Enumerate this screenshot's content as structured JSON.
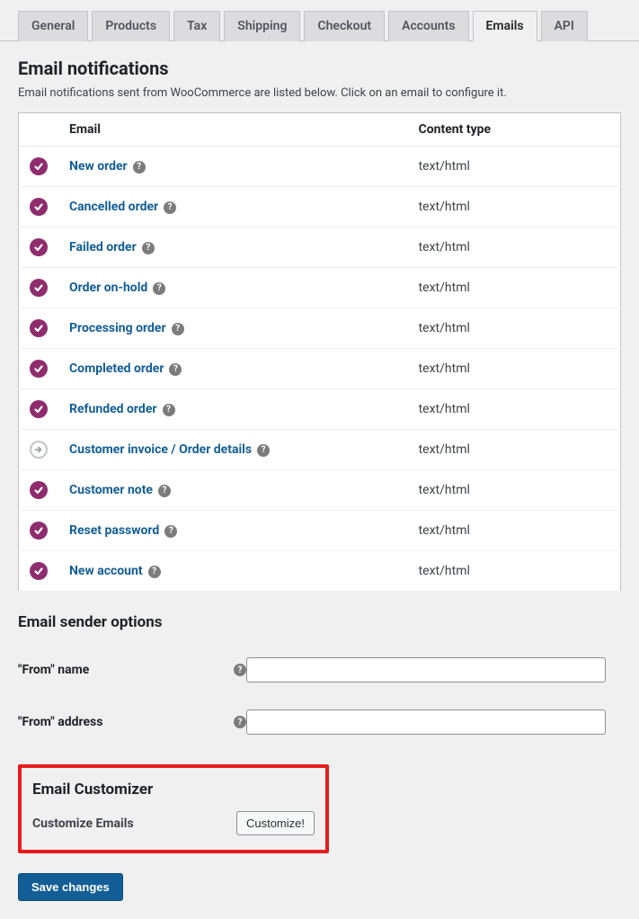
{
  "tabs": [
    {
      "label": "General"
    },
    {
      "label": "Products"
    },
    {
      "label": "Tax"
    },
    {
      "label": "Shipping"
    },
    {
      "label": "Checkout"
    },
    {
      "label": "Accounts"
    },
    {
      "label": "Emails"
    },
    {
      "label": "API"
    }
  ],
  "active_tab_index": 6,
  "section": {
    "heading": "Email notifications",
    "description": "Email notifications sent from WooCommerce are listed below. Click on an email to configure it."
  },
  "table": {
    "columns": {
      "email": "Email",
      "content_type": "Content type"
    },
    "rows": [
      {
        "status": "enabled",
        "name": "New order",
        "content_type": "text/html"
      },
      {
        "status": "enabled",
        "name": "Cancelled order",
        "content_type": "text/html"
      },
      {
        "status": "enabled",
        "name": "Failed order",
        "content_type": "text/html"
      },
      {
        "status": "enabled",
        "name": "Order on-hold",
        "content_type": "text/html"
      },
      {
        "status": "enabled",
        "name": "Processing order",
        "content_type": "text/html"
      },
      {
        "status": "enabled",
        "name": "Completed order",
        "content_type": "text/html"
      },
      {
        "status": "enabled",
        "name": "Refunded order",
        "content_type": "text/html"
      },
      {
        "status": "manual",
        "name": "Customer invoice / Order details",
        "content_type": "text/html"
      },
      {
        "status": "enabled",
        "name": "Customer note",
        "content_type": "text/html"
      },
      {
        "status": "enabled",
        "name": "Reset password",
        "content_type": "text/html"
      },
      {
        "status": "enabled",
        "name": "New account",
        "content_type": "text/html"
      }
    ]
  },
  "sender": {
    "heading": "Email sender options",
    "from_name_label": "\"From\" name",
    "from_name_value": "",
    "from_address_label": "\"From\" address",
    "from_address_value": ""
  },
  "customizer": {
    "heading": "Email Customizer",
    "row_label": "Customize Emails",
    "button": "Customize!"
  },
  "save_button": "Save changes",
  "help_glyph": "?"
}
